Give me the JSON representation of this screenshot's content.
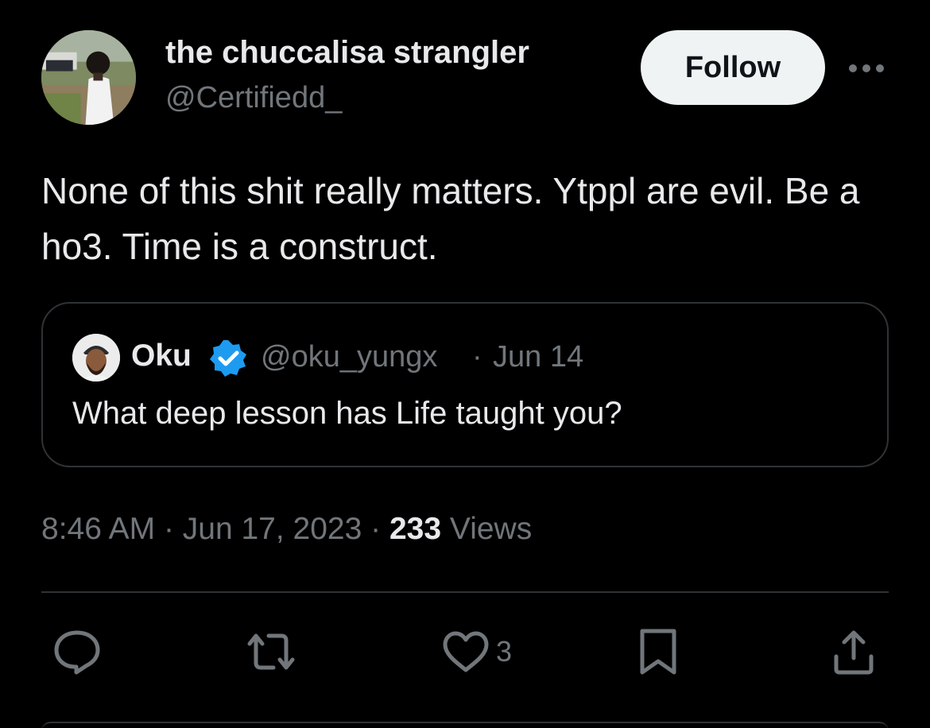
{
  "author": {
    "display_name": "the chuccalisa strangler",
    "handle": "@Certifiedd_"
  },
  "follow_label": "Follow",
  "tweet_text": "None of this shit really matters. Ytppl are evil. Be a ho3. Time is a construct.",
  "quoted": {
    "name": "Oku",
    "verified": true,
    "handle": "@oku_yungx",
    "separator": "·",
    "date": "Jun 14",
    "text": "What deep lesson has Life taught you?"
  },
  "meta": {
    "time": "8:46 AM",
    "date": "Jun 17, 2023",
    "views_count": "233",
    "views_label": "Views"
  },
  "actions": {
    "reply_icon": "reply-icon",
    "retweet_icon": "retweet-icon",
    "like_icon": "heart-icon",
    "like_count": "3",
    "bookmark_icon": "bookmark-icon",
    "share_icon": "share-icon"
  },
  "colors": {
    "background": "#000000",
    "primary_text": "#e7e9ea",
    "secondary_text": "#71767b",
    "border": "#2f3336",
    "follow_bg": "#eff3f4",
    "verified_blue": "#1d9bf0"
  }
}
